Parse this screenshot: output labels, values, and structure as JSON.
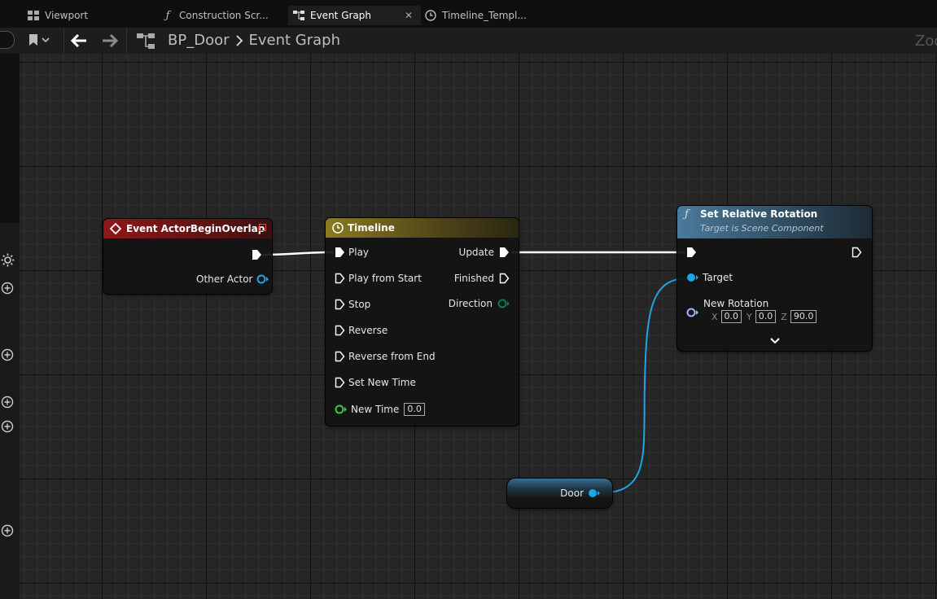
{
  "tabs": [
    {
      "label": "Viewport",
      "icon": "grid-icon"
    },
    {
      "label": "Construction Scr...",
      "icon": "function-icon"
    },
    {
      "label": "Event Graph",
      "icon": "graph-icon",
      "active": true
    },
    {
      "label": "Timeline_Templ...",
      "icon": "clock-icon"
    }
  ],
  "breadcrumb": {
    "root": "BP_Door",
    "current": "Event Graph"
  },
  "zoom_text": "Zoo",
  "nodes": {
    "event": {
      "title": "Event ActorBeginOverlap",
      "pin_other_actor": "Other Actor"
    },
    "timeline": {
      "title": "Timeline",
      "inputs": [
        "Play",
        "Play from Start",
        "Stop",
        "Reverse",
        "Reverse from End",
        "Set New Time"
      ],
      "new_time_label": "New Time",
      "new_time_value": "0.0",
      "outputs": [
        "Update",
        "Finished",
        "Direction"
      ]
    },
    "set_rotation": {
      "title": "Set Relative Rotation",
      "subtitle": "Target is Scene Component",
      "pin_target": "Target",
      "pin_new_rotation": "New Rotation",
      "x_label": "X",
      "x_value": "0.0",
      "y_label": "Y",
      "y_value": "0.0",
      "z_label": "Z",
      "z_value": "90.0"
    },
    "door": {
      "label": "Door"
    }
  },
  "colors": {
    "event_header": "#8b1a1a",
    "timeline_header": "#7a6a1a",
    "function_header": "#3e6a8c",
    "object_pin": "#1fa4e8",
    "float_pin": "#38d13c",
    "exec_wire": "#ffffff"
  }
}
